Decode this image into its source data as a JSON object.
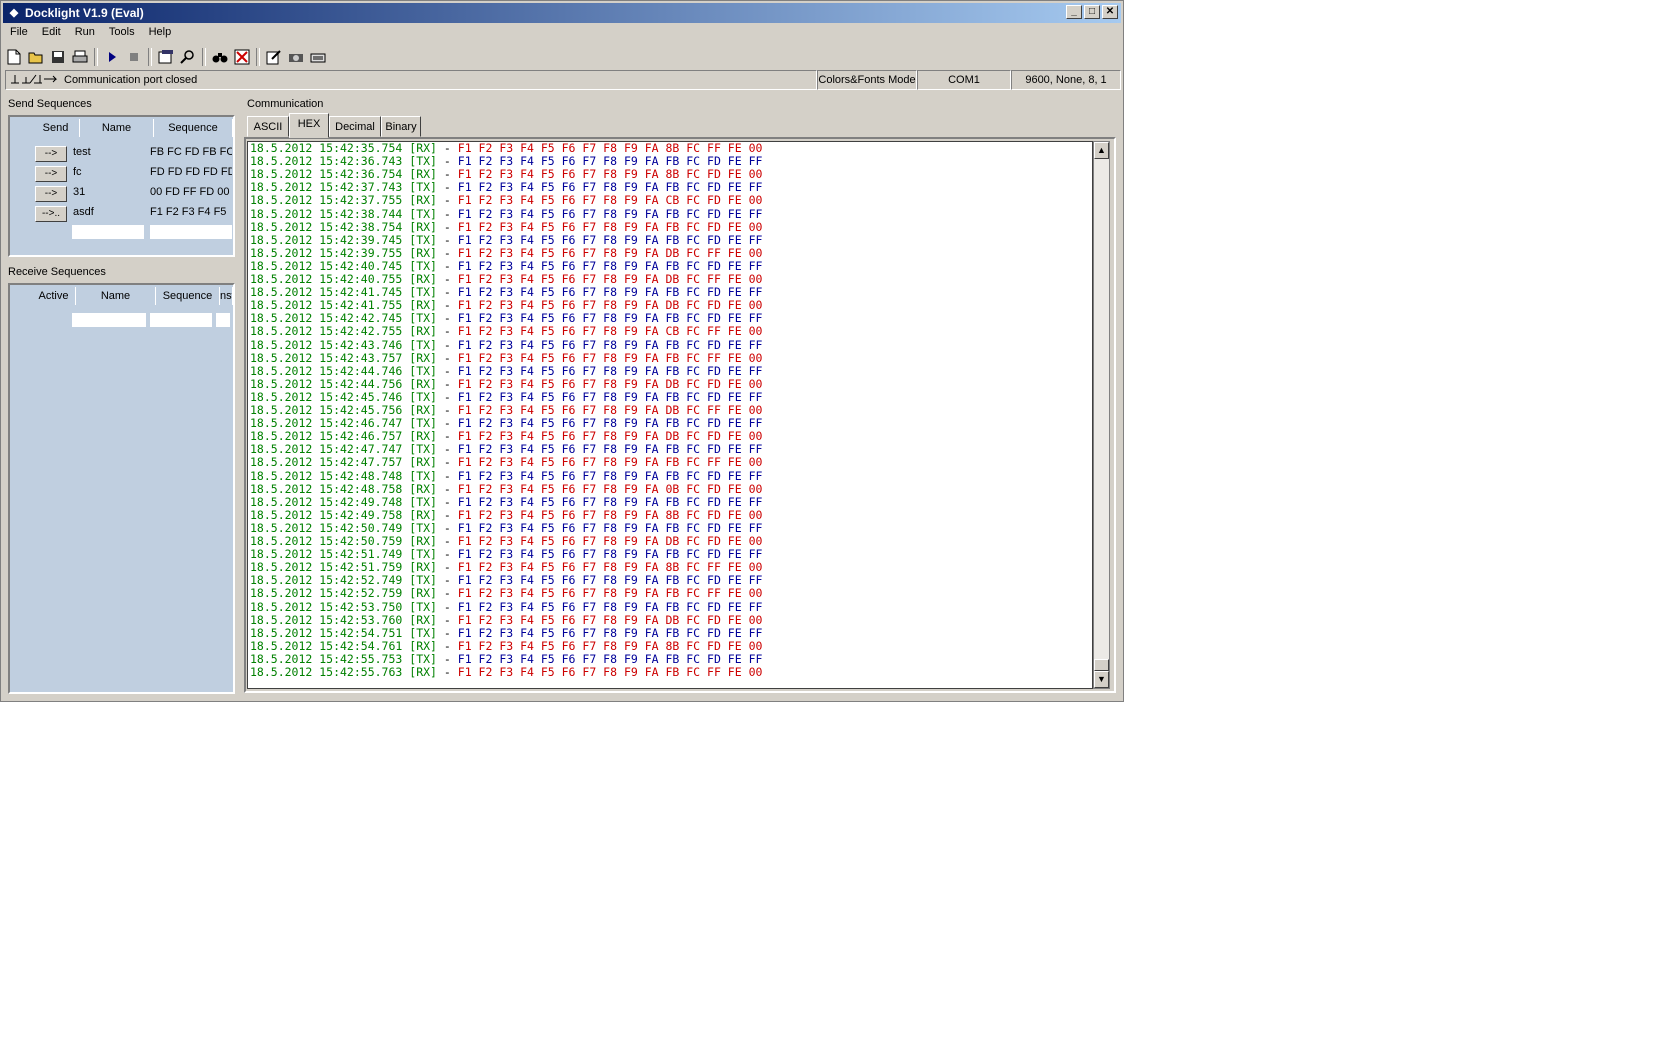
{
  "window": {
    "title": "Docklight V1.9 (Eval)",
    "controls": {
      "min": "_",
      "max": "□",
      "close": "✕"
    }
  },
  "menu": [
    "File",
    "Edit",
    "Run",
    "Tools",
    "Help"
  ],
  "toolbar": [
    "new-file-icon",
    "open-folder-icon",
    "save-icon",
    "print-icon",
    "run-icon",
    "stop-icon",
    "settings-icon",
    "find-icon",
    "binoculars-icon",
    "clear-icon",
    "edit-icon",
    "snapshot-icon",
    "keyboard-icon"
  ],
  "status": {
    "connection_text": "Communication port closed",
    "mode": "Colors&Fonts Mode",
    "port": "COM1",
    "settings": "9600, None, 8, 1"
  },
  "send_sequences": {
    "title": "Send Sequences",
    "columns": [
      "Send",
      "Name",
      "Sequence"
    ],
    "rows": [
      {
        "button": "-->",
        "name": "test",
        "sequence": "FB FC FD FB FC"
      },
      {
        "button": "-->",
        "name": "fc",
        "sequence": "FD FD FD FD FD"
      },
      {
        "button": "-->",
        "name": "31",
        "sequence": "00 FD FF FD 00"
      },
      {
        "button": "-->..",
        "name": "asdf",
        "sequence": "F1 F2 F3 F4 F5"
      }
    ]
  },
  "receive_sequences": {
    "title": "Receive Sequences",
    "columns": [
      "Active",
      "Name",
      "Sequence",
      "nsw"
    ]
  },
  "communication": {
    "title": "Communication",
    "tabs": [
      "ASCII",
      "HEX",
      "Decimal",
      "Binary"
    ],
    "active_tab": "HEX",
    "log": [
      {
        "ts": "18.5.2012 15:42:35.754",
        "dir": "[RX]",
        "data": "F1 F2 F3 F4 F5 F6 F7 F8 F9 FA 8B FC FF FE 00"
      },
      {
        "ts": "18.5.2012 15:42:36.743",
        "dir": "[TX]",
        "data": "F1 F2 F3 F4 F5 F6 F7 F8 F9 FA FB FC FD FE FF"
      },
      {
        "ts": "18.5.2012 15:42:36.754",
        "dir": "[RX]",
        "data": "F1 F2 F3 F4 F5 F6 F7 F8 F9 FA 8B FC FD FE 00"
      },
      {
        "ts": "18.5.2012 15:42:37.743",
        "dir": "[TX]",
        "data": "F1 F2 F3 F4 F5 F6 F7 F8 F9 FA FB FC FD FE FF"
      },
      {
        "ts": "18.5.2012 15:42:37.755",
        "dir": "[RX]",
        "data": "F1 F2 F3 F4 F5 F6 F7 F8 F9 FA CB FC FD FE 00"
      },
      {
        "ts": "18.5.2012 15:42:38.744",
        "dir": "[TX]",
        "data": "F1 F2 F3 F4 F5 F6 F7 F8 F9 FA FB FC FD FE FF"
      },
      {
        "ts": "18.5.2012 15:42:38.754",
        "dir": "[RX]",
        "data": "F1 F2 F3 F4 F5 F6 F7 F8 F9 FA FB FC FD FE 00"
      },
      {
        "ts": "18.5.2012 15:42:39.745",
        "dir": "[TX]",
        "data": "F1 F2 F3 F4 F5 F6 F7 F8 F9 FA FB FC FD FE FF"
      },
      {
        "ts": "18.5.2012 15:42:39.755",
        "dir": "[RX]",
        "data": "F1 F2 F3 F4 F5 F6 F7 F8 F9 FA DB FC FF FE 00"
      },
      {
        "ts": "18.5.2012 15:42:40.745",
        "dir": "[TX]",
        "data": "F1 F2 F3 F4 F5 F6 F7 F8 F9 FA FB FC FD FE FF"
      },
      {
        "ts": "18.5.2012 15:42:40.755",
        "dir": "[RX]",
        "data": "F1 F2 F3 F4 F5 F6 F7 F8 F9 FA DB FC FF FE 00"
      },
      {
        "ts": "18.5.2012 15:42:41.745",
        "dir": "[TX]",
        "data": "F1 F2 F3 F4 F5 F6 F7 F8 F9 FA FB FC FD FE FF"
      },
      {
        "ts": "18.5.2012 15:42:41.755",
        "dir": "[RX]",
        "data": "F1 F2 F3 F4 F5 F6 F7 F8 F9 FA DB FC FD FE 00"
      },
      {
        "ts": "18.5.2012 15:42:42.745",
        "dir": "[TX]",
        "data": "F1 F2 F3 F4 F5 F6 F7 F8 F9 FA FB FC FD FE FF"
      },
      {
        "ts": "18.5.2012 15:42:42.755",
        "dir": "[RX]",
        "data": "F1 F2 F3 F4 F5 F6 F7 F8 F9 FA CB FC FF FE 00"
      },
      {
        "ts": "18.5.2012 15:42:43.746",
        "dir": "[TX]",
        "data": "F1 F2 F3 F4 F5 F6 F7 F8 F9 FA FB FC FD FE FF"
      },
      {
        "ts": "18.5.2012 15:42:43.757",
        "dir": "[RX]",
        "data": "F1 F2 F3 F4 F5 F6 F7 F8 F9 FA FB FC FF FE 00"
      },
      {
        "ts": "18.5.2012 15:42:44.746",
        "dir": "[TX]",
        "data": "F1 F2 F3 F4 F5 F6 F7 F8 F9 FA FB FC FD FE FF"
      },
      {
        "ts": "18.5.2012 15:42:44.756",
        "dir": "[RX]",
        "data": "F1 F2 F3 F4 F5 F6 F7 F8 F9 FA DB FC FD FE 00"
      },
      {
        "ts": "18.5.2012 15:42:45.746",
        "dir": "[TX]",
        "data": "F1 F2 F3 F4 F5 F6 F7 F8 F9 FA FB FC FD FE FF"
      },
      {
        "ts": "18.5.2012 15:42:45.756",
        "dir": "[RX]",
        "data": "F1 F2 F3 F4 F5 F6 F7 F8 F9 FA DB FC FF FE 00"
      },
      {
        "ts": "18.5.2012 15:42:46.747",
        "dir": "[TX]",
        "data": "F1 F2 F3 F4 F5 F6 F7 F8 F9 FA FB FC FD FE FF"
      },
      {
        "ts": "18.5.2012 15:42:46.757",
        "dir": "[RX]",
        "data": "F1 F2 F3 F4 F5 F6 F7 F8 F9 FA DB FC FD FE 00"
      },
      {
        "ts": "18.5.2012 15:42:47.747",
        "dir": "[TX]",
        "data": "F1 F2 F3 F4 F5 F6 F7 F8 F9 FA FB FC FD FE FF"
      },
      {
        "ts": "18.5.2012 15:42:47.757",
        "dir": "[RX]",
        "data": "F1 F2 F3 F4 F5 F6 F7 F8 F9 FA FB FC FF FE 00"
      },
      {
        "ts": "18.5.2012 15:42:48.748",
        "dir": "[TX]",
        "data": "F1 F2 F3 F4 F5 F6 F7 F8 F9 FA FB FC FD FE FF"
      },
      {
        "ts": "18.5.2012 15:42:48.758",
        "dir": "[RX]",
        "data": "F1 F2 F3 F4 F5 F6 F7 F8 F9 FA 0B FC FD FE 00"
      },
      {
        "ts": "18.5.2012 15:42:49.748",
        "dir": "[TX]",
        "data": "F1 F2 F3 F4 F5 F6 F7 F8 F9 FA FB FC FD FE FF"
      },
      {
        "ts": "18.5.2012 15:42:49.758",
        "dir": "[RX]",
        "data": "F1 F2 F3 F4 F5 F6 F7 F8 F9 FA 8B FC FD FE 00"
      },
      {
        "ts": "18.5.2012 15:42:50.749",
        "dir": "[TX]",
        "data": "F1 F2 F3 F4 F5 F6 F7 F8 F9 FA FB FC FD FE FF"
      },
      {
        "ts": "18.5.2012 15:42:50.759",
        "dir": "[RX]",
        "data": "F1 F2 F3 F4 F5 F6 F7 F8 F9 FA DB FC FD FE 00"
      },
      {
        "ts": "18.5.2012 15:42:51.749",
        "dir": "[TX]",
        "data": "F1 F2 F3 F4 F5 F6 F7 F8 F9 FA FB FC FD FE FF"
      },
      {
        "ts": "18.5.2012 15:42:51.759",
        "dir": "[RX]",
        "data": "F1 F2 F3 F4 F5 F6 F7 F8 F9 FA 8B FC FF FE 00"
      },
      {
        "ts": "18.5.2012 15:42:52.749",
        "dir": "[TX]",
        "data": "F1 F2 F3 F4 F5 F6 F7 F8 F9 FA FB FC FD FE FF"
      },
      {
        "ts": "18.5.2012 15:42:52.759",
        "dir": "[RX]",
        "data": "F1 F2 F3 F4 F5 F6 F7 F8 F9 FA FB FC FF FE 00"
      },
      {
        "ts": "18.5.2012 15:42:53.750",
        "dir": "[TX]",
        "data": "F1 F2 F3 F4 F5 F6 F7 F8 F9 FA FB FC FD FE FF"
      },
      {
        "ts": "18.5.2012 15:42:53.760",
        "dir": "[RX]",
        "data": "F1 F2 F3 F4 F5 F6 F7 F8 F9 FA DB FC FD FE 00"
      },
      {
        "ts": "18.5.2012 15:42:54.751",
        "dir": "[TX]",
        "data": "F1 F2 F3 F4 F5 F6 F7 F8 F9 FA FB FC FD FE FF"
      },
      {
        "ts": "18.5.2012 15:42:54.761",
        "dir": "[RX]",
        "data": "F1 F2 F3 F4 F5 F6 F7 F8 F9 FA 8B FC FD FE 00"
      },
      {
        "ts": "18.5.2012 15:42:55.753",
        "dir": "[TX]",
        "data": "F1 F2 F3 F4 F5 F6 F7 F8 F9 FA FB FC FD FE FF"
      },
      {
        "ts": "18.5.2012 15:42:55.763",
        "dir": "[RX]",
        "data": "F1 F2 F3 F4 F5 F6 F7 F8 F9 FA FB FC FF FE 00"
      }
    ],
    "colors": {
      "timestamp": "#008000",
      "rx": "#cc0000",
      "tx": "#000099"
    },
    "separator": "-"
  }
}
